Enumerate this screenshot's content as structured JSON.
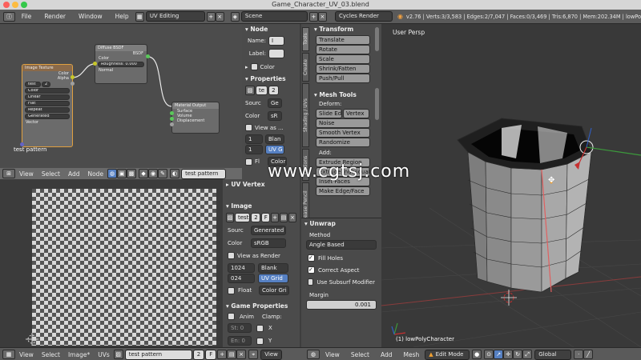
{
  "window": {
    "title": "Game_Character_UV_03.blend"
  },
  "topbar": {
    "menus": [
      "File",
      "Render",
      "Window",
      "Help"
    ],
    "layout": "UV Editing",
    "scene": "Scene",
    "engine": "Cycles Render",
    "stats": "v2.76 | Verts:3/3,583 | Edges:2/7,047 | Faces:0/3,469 | Tris:6,870 | Mem:202.34M | lowPo"
  },
  "node_editor": {
    "image_texture": {
      "title": "Image Texture",
      "out1": "Color",
      "out2": "Alpha",
      "image": "test",
      "img_num": "2",
      "color": "Color",
      "interp": "Linear",
      "proj": "Flat",
      "ext": "Repeat",
      "source": "Generated",
      "vector": "Vector",
      "caption": "test pattern"
    },
    "diffuse": {
      "title": "Diffuse BSDF",
      "out": "BSDF",
      "in1": "Color",
      "roughness": "Roughness: 0.000",
      "in3": "Normal"
    },
    "output": {
      "title": "Material Output",
      "in1": "Surface",
      "in2": "Volume",
      "in3": "Displacement"
    },
    "header": {
      "view": "View",
      "select": "Select",
      "add": "Add",
      "node": "Node",
      "image": "test pattern"
    }
  },
  "node_panel": {
    "node_title": "Node",
    "name_label": "Name:",
    "name_val": "I",
    "label_label": "Label:",
    "color_label": "Color",
    "properties_title": "Properties",
    "img_name": "te",
    "img_num": "2",
    "source_label": "Sourc",
    "source_val": "Ge",
    "color_label2": "Color",
    "color_val": "sR",
    "view_as": "View as ...",
    "w": "1",
    "h": "1",
    "blank": "Blan",
    "uvgrid": "UV G",
    "fl": "Fl",
    "colorg": "Color"
  },
  "uv_panel": {
    "title": "UV Vertex",
    "image_title": "Image",
    "img_name": "test",
    "img_num": "2",
    "img_f": "F",
    "source_label": "Sourc",
    "source_val": "Generated",
    "color_label": "Color",
    "color_val": "sRGB",
    "view_as_render": "View as Render",
    "width": "1024",
    "height": "024",
    "blank": "Blank",
    "uv_grid": "UV Grid",
    "float": "Float",
    "color_grid": "Color Gri",
    "game_props": "Game Properties",
    "anim": "Anim",
    "clamp": "Clamp:",
    "st": "St: 0",
    "en": "En: 0",
    "x": "X",
    "y": "Y"
  },
  "tools": {
    "tabs": [
      "Tools",
      "Create",
      "Shading / UVs",
      "Options",
      "Grease Pencil"
    ],
    "transform_title": "Transform",
    "transform": [
      "Translate",
      "Rotate",
      "Scale",
      "Shrink/Fatten",
      "Push/Pull"
    ],
    "mesh_tools_title": "Mesh Tools",
    "deform": "Deform:",
    "slide_edge": "Slide Ed",
    "vertex": "Vertex",
    "noise": "Noise",
    "smooth_vertex": "Smooth Vertex",
    "randomize": "Randomize",
    "add": "Add:",
    "extrude_region": "Extrude Region",
    "extrude_individual": "Extrude Individual",
    "inset_faces": "Inset Faces",
    "make_edge_face": "Make Edge/Face",
    "unwrap_title": "Unwrap",
    "method_label": "Method",
    "method_val": "Angle Based",
    "fill_holes": "Fill Holes",
    "correct_aspect": "Correct Aspect",
    "use_subsurf": "Use Subsurf Modifier",
    "margin_label": "Margin",
    "margin_val": "0.001"
  },
  "viewport": {
    "label": "User Persp",
    "object": "(1) lowPolyCharacter",
    "watermark": "www.cgtsj.com"
  },
  "bottombar": {
    "uv": {
      "view": "View",
      "select": "Select",
      "image": "Image*",
      "uvs": "UVs",
      "img_name": "test pattern",
      "img_num": "2",
      "view2": "View"
    },
    "v3d": {
      "view": "View",
      "select": "Select",
      "add": "Add",
      "mesh": "Mesh",
      "mode": "Edit Mode",
      "pivot": "Global"
    }
  }
}
